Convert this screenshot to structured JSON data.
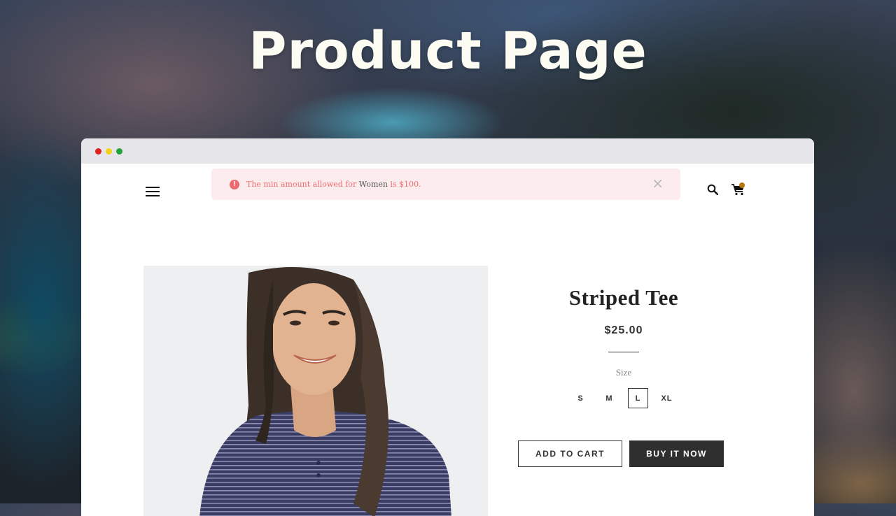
{
  "hero": {
    "title": "Product Page"
  },
  "browser": {
    "window_controls": [
      "close",
      "minimize",
      "maximize"
    ],
    "colors": {
      "close": "#e0201c",
      "minimize": "#f1d21a",
      "maximize": "#23a23a"
    }
  },
  "header": {
    "menu_icon": "hamburger-menu-icon",
    "search_icon": "search-icon",
    "cart_icon": "cart-icon",
    "cart_badge_color": "#b5750f"
  },
  "alert": {
    "icon": "exclamation-icon",
    "icon_glyph": "!",
    "text_before": "The min amount allowed for ",
    "highlight": "Women",
    "text_after": " is $100.",
    "close_glyph": "×",
    "color": "#ec6b6e",
    "background": "#fdeced"
  },
  "product": {
    "title": "Striped Tee",
    "price": "$25.00",
    "size_label": "Size",
    "sizes": [
      "S",
      "M",
      "L",
      "XL"
    ],
    "selected_size": "L",
    "image_alt": "Woman wearing navy striped henley tee"
  },
  "actions": {
    "add_to_cart": "ADD TO CART",
    "buy_now": "BUY IT NOW"
  }
}
